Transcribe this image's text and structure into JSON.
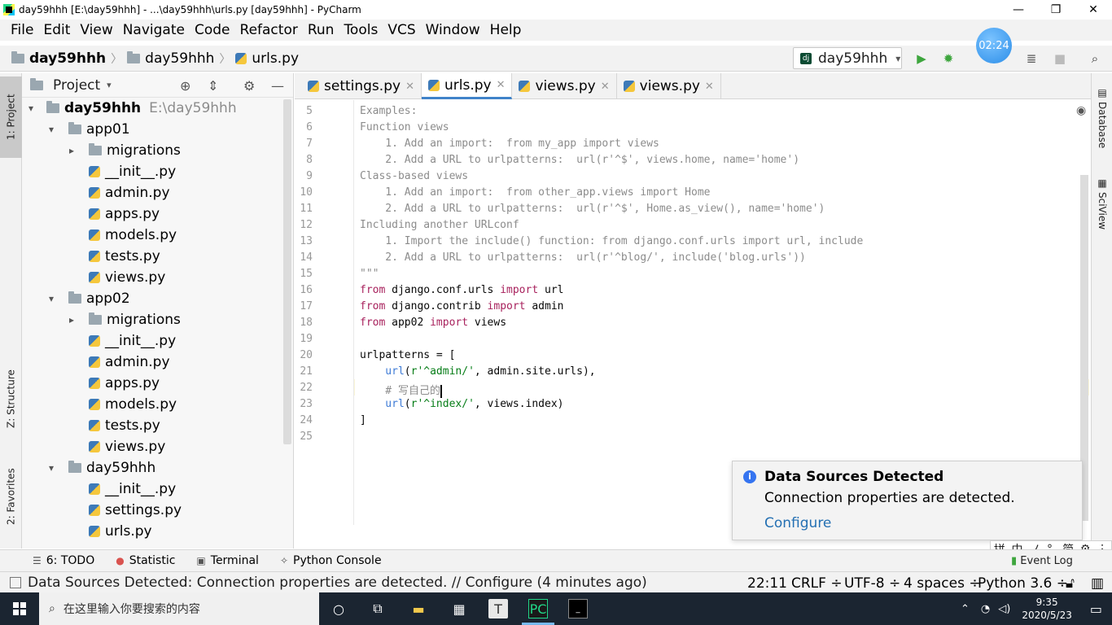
{
  "window": {
    "title": "day59hhh [E:\\day59hhh] - ...\\day59hhh\\urls.py [day59hhh] - PyCharm",
    "min": "—",
    "max": "❐",
    "close": "✕"
  },
  "menu": [
    "File",
    "Edit",
    "View",
    "Navigate",
    "Code",
    "Refactor",
    "Run",
    "Tools",
    "VCS",
    "Window",
    "Help"
  ],
  "breadcrumb": [
    "day59hhh",
    "day59hhh",
    "urls.py"
  ],
  "run_config": {
    "label": "day59hhh"
  },
  "timer": "02:24",
  "left_stripe": {
    "project": "1: Project",
    "structure": "Z: Structure",
    "favorites": "2: Favorites"
  },
  "right_stripe": {
    "database": "Database",
    "sciview": "SciView"
  },
  "project_panel": {
    "title": "Project",
    "root": {
      "name": "day59hhh",
      "path": "E:\\day59hhh"
    },
    "tree": [
      {
        "label": "app01",
        "type": "folder",
        "level": 1,
        "arrow": "▾"
      },
      {
        "label": "migrations",
        "type": "folder",
        "level": 2,
        "arrow": "▸"
      },
      {
        "label": "__init__.py",
        "type": "file",
        "level": 2
      },
      {
        "label": "admin.py",
        "type": "file",
        "level": 2
      },
      {
        "label": "apps.py",
        "type": "file",
        "level": 2
      },
      {
        "label": "models.py",
        "type": "file",
        "level": 2
      },
      {
        "label": "tests.py",
        "type": "file",
        "level": 2
      },
      {
        "label": "views.py",
        "type": "file",
        "level": 2
      },
      {
        "label": "app02",
        "type": "folder",
        "level": 1,
        "arrow": "▾"
      },
      {
        "label": "migrations",
        "type": "folder",
        "level": 2,
        "arrow": "▸"
      },
      {
        "label": "__init__.py",
        "type": "file",
        "level": 2
      },
      {
        "label": "admin.py",
        "type": "file",
        "level": 2
      },
      {
        "label": "apps.py",
        "type": "file",
        "level": 2
      },
      {
        "label": "models.py",
        "type": "file",
        "level": 2
      },
      {
        "label": "tests.py",
        "type": "file",
        "level": 2
      },
      {
        "label": "views.py",
        "type": "file",
        "level": 2
      },
      {
        "label": "day59hhh",
        "type": "folder",
        "level": 1,
        "arrow": "▾"
      },
      {
        "label": "__init__.py",
        "type": "file",
        "level": 2
      },
      {
        "label": "settings.py",
        "type": "file",
        "level": 2
      },
      {
        "label": "urls.py",
        "type": "file",
        "level": 2
      }
    ]
  },
  "editor_tabs": [
    {
      "label": "settings.py",
      "active": false
    },
    {
      "label": "urls.py",
      "active": true
    },
    {
      "label": "views.py",
      "active": false
    },
    {
      "label": "views.py",
      "active": false
    }
  ],
  "code_lines": [
    {
      "n": "5",
      "parts": [
        [
          "cm",
          "Examples:"
        ]
      ]
    },
    {
      "n": "6",
      "parts": [
        [
          "cm",
          "Function views"
        ]
      ]
    },
    {
      "n": "7",
      "parts": [
        [
          "cm",
          "    1. Add an import:  from my_app import views"
        ]
      ]
    },
    {
      "n": "8",
      "parts": [
        [
          "cm",
          "    2. Add a URL to urlpatterns:  url(r'^$', views.home, name='home')"
        ]
      ]
    },
    {
      "n": "9",
      "parts": [
        [
          "cm",
          "Class-based views"
        ]
      ]
    },
    {
      "n": "10",
      "parts": [
        [
          "cm",
          "    1. Add an import:  from other_app.views import Home"
        ]
      ]
    },
    {
      "n": "11",
      "parts": [
        [
          "cm",
          "    2. Add a URL to urlpatterns:  url(r'^$', Home.as_view(), name='home')"
        ]
      ]
    },
    {
      "n": "12",
      "parts": [
        [
          "cm",
          "Including another URLconf"
        ]
      ]
    },
    {
      "n": "13",
      "parts": [
        [
          "cm",
          "    1. Import the include() function: from django.conf.urls import url, include"
        ]
      ]
    },
    {
      "n": "14",
      "parts": [
        [
          "cm",
          "    2. Add a URL to urlpatterns:  url(r'^blog/', include('blog.urls'))"
        ]
      ]
    },
    {
      "n": "15",
      "parts": [
        [
          "cm",
          "\"\"\""
        ]
      ]
    },
    {
      "n": "16",
      "parts": [
        [
          "kw",
          "from"
        ],
        [
          "plain",
          " django.conf.urls "
        ],
        [
          "kw",
          "import"
        ],
        [
          "plain",
          " url"
        ]
      ]
    },
    {
      "n": "17",
      "parts": [
        [
          "kw",
          "from"
        ],
        [
          "plain",
          " django.contrib "
        ],
        [
          "kw",
          "import"
        ],
        [
          "plain",
          " admin"
        ]
      ]
    },
    {
      "n": "18",
      "parts": [
        [
          "kw",
          "from"
        ],
        [
          "plain",
          " app02 "
        ],
        [
          "kw",
          "import"
        ],
        [
          "plain",
          " views"
        ]
      ]
    },
    {
      "n": "19",
      "parts": []
    },
    {
      "n": "20",
      "parts": [
        [
          "plain",
          "urlpatterns = ["
        ]
      ]
    },
    {
      "n": "21",
      "parts": [
        [
          "fn",
          "    url"
        ],
        [
          "plain",
          "("
        ],
        [
          "str",
          "r'^admin/'"
        ],
        [
          "plain",
          ", admin.site.urls),"
        ]
      ]
    },
    {
      "n": "22",
      "parts": [
        [
          "cm",
          "    # 写自己的"
        ]
      ]
    },
    {
      "n": "23",
      "parts": [
        [
          "fn",
          "    url"
        ],
        [
          "plain",
          "("
        ],
        [
          "str",
          "r'^index/'"
        ],
        [
          "plain",
          ", views.index)"
        ]
      ]
    },
    {
      "n": "24",
      "parts": [
        [
          "plain",
          "]"
        ]
      ]
    },
    {
      "n": "25",
      "parts": []
    }
  ],
  "notification": {
    "title": "Data Sources Detected",
    "body": "Connection properties are detected.",
    "link": "Configure"
  },
  "bottom_tools": [
    "6: TODO",
    "Statistic",
    "Terminal",
    "Python Console"
  ],
  "event_log": "Event Log",
  "ime": [
    "拼",
    "中",
    "ノ",
    "°,",
    "简",
    "⚙",
    "⋮"
  ],
  "status": {
    "message": "Data Sources Detected: Connection properties are detected. // Configure (4 minutes ago)",
    "position": "22:11",
    "line_sep": "CRLF ÷",
    "encoding": "UTF-8 ÷",
    "indent": "4 spaces ÷",
    "interpreter": "Python 3.6 ÷"
  },
  "taskbar": {
    "search_placeholder": "在这里输入你要搜索的内容",
    "time": "9:35",
    "date": "2020/5/23"
  }
}
